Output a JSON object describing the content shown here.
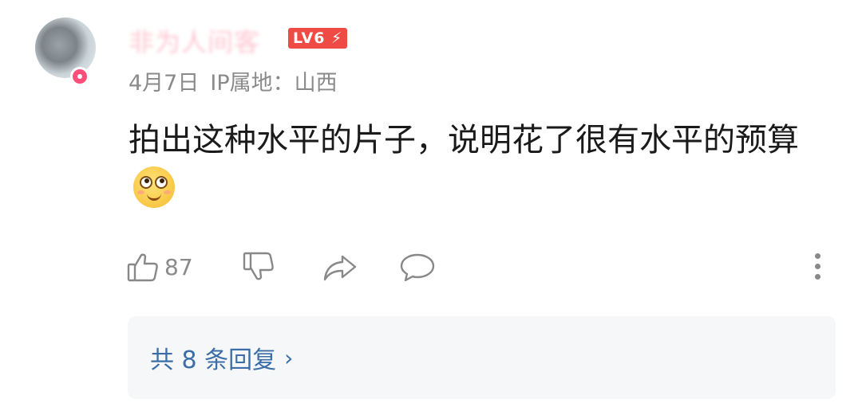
{
  "comment": {
    "username": "非为人间客",
    "level": "LV6",
    "date": "4月7日",
    "ip_location": "IP属地：山西",
    "text": "拍出这种水平的片子，说明花了很有水平的预算",
    "emoji": "rolling-eyes-emoji",
    "likes": "87"
  },
  "replies": {
    "label": "共 8 条回复",
    "chevron": "›"
  },
  "colors": {
    "level_badge": "#f04a44",
    "reply_link": "#3b6ea8",
    "meta_text": "#8a8a8a"
  }
}
